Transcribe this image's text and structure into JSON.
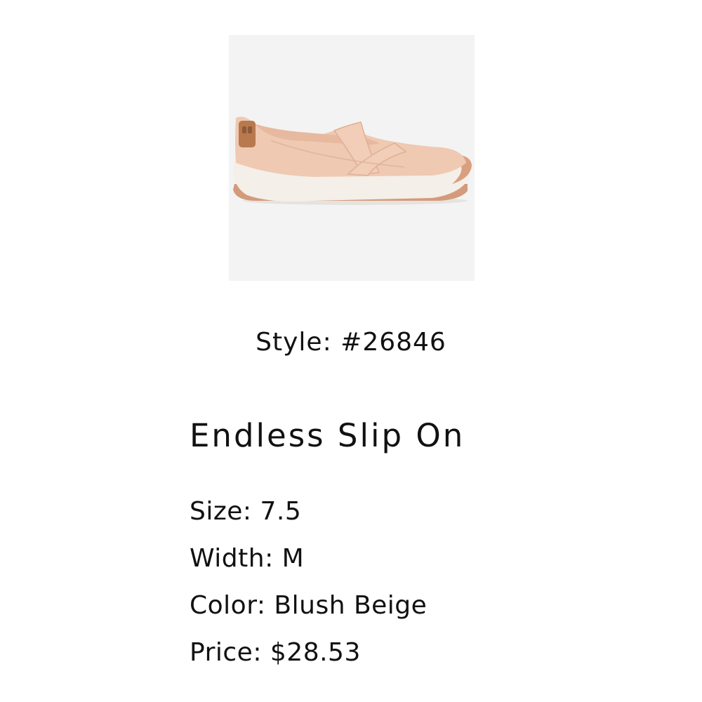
{
  "product": {
    "image_icon": "slip-on-shoe-photo",
    "style_text": "Style: #26846",
    "title": "Endless Slip On",
    "details": {
      "size": "Size: 7.5",
      "width": "Width: M",
      "color": "Color: Blush Beige",
      "price": "Price: $28.53"
    }
  },
  "colors": {
    "image_background": "#f3f3f3",
    "shoe_upper": "#efc9b2",
    "sole": "#f4efe8",
    "outsole_accent": "#d49a7c",
    "heel_tab": "#b8794f"
  }
}
